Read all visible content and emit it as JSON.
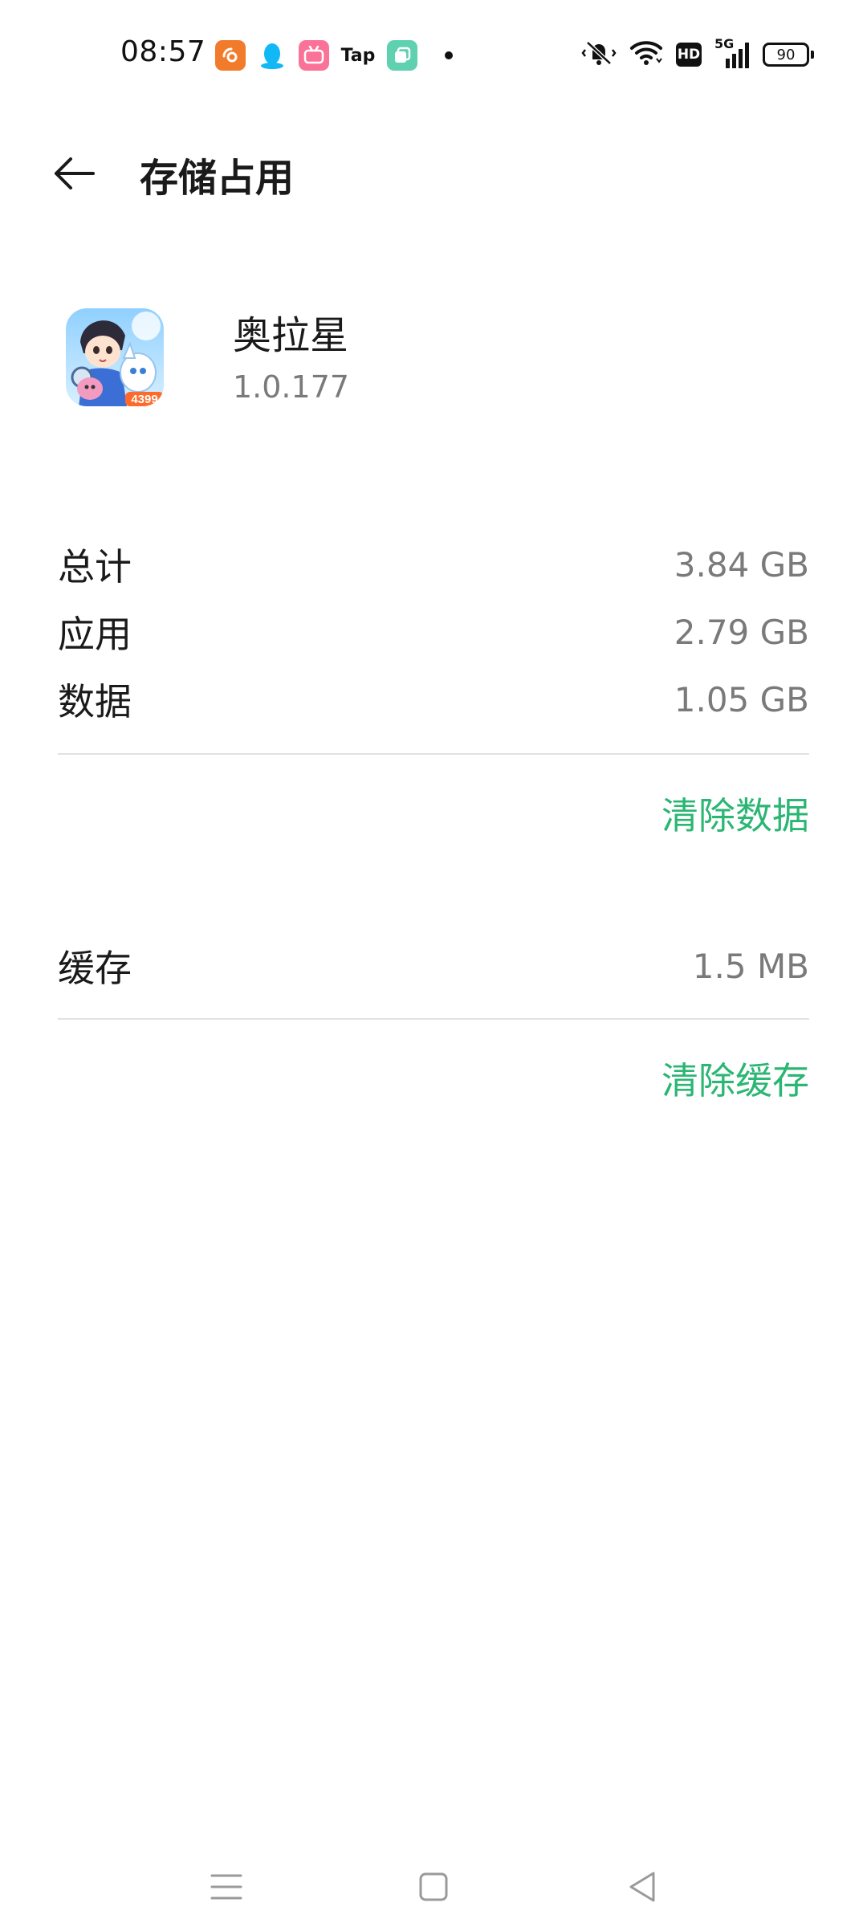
{
  "status_bar": {
    "time": "08:57",
    "notification_icons": [
      {
        "name": "uc-browser-icon",
        "color": "#f27a2b"
      },
      {
        "name": "qq-icon",
        "color": "#12b7f5"
      },
      {
        "name": "bilibili-icon",
        "color": "#fb7299"
      },
      {
        "name": "taptap-icon",
        "label": "Tap"
      },
      {
        "name": "multitask-icon",
        "color": "#5fd0b0"
      }
    ],
    "network": "5G",
    "hd_label": "HD",
    "battery_level": "90"
  },
  "header": {
    "title": "存储占用"
  },
  "app": {
    "name": "奥拉星",
    "version": "1.0.177",
    "icon_badge": "4399"
  },
  "storage": {
    "total_label": "总计",
    "total_value": "3.84 GB",
    "app_label": "应用",
    "app_value": "2.79 GB",
    "data_label": "数据",
    "data_value": "1.05 GB",
    "clear_data_label": "清除数据",
    "cache_label": "缓存",
    "cache_value": "1.5 MB",
    "clear_cache_label": "清除缓存"
  },
  "colors": {
    "accent": "#2bb673",
    "secondary_text": "#7a7a7a"
  }
}
